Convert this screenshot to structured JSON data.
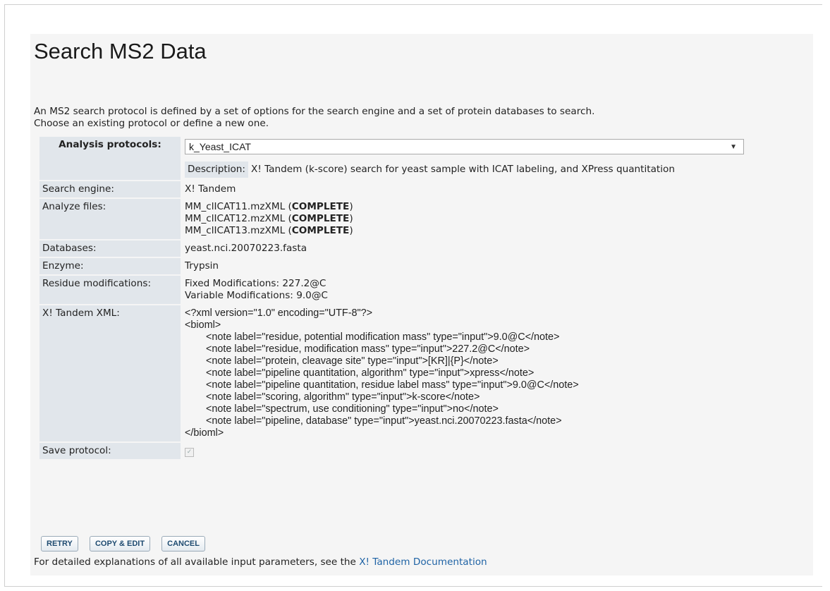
{
  "page": {
    "title": "Search MS2 Data",
    "intro_line1": "An MS2 search protocol is defined by a set of options for the search engine and a set of protein databases to search.",
    "intro_line2": "Choose an existing protocol or define a new one."
  },
  "form": {
    "protocol_label": "Analysis protocols:",
    "protocol_value": "k_Yeast_ICAT",
    "description_label": "Description:",
    "description_value": "X! Tandem (k-score) search for yeast sample with ICAT labeling, and XPress quantitation",
    "engine_label": "Search engine:",
    "engine_value": "X! Tandem",
    "files_label": "Analyze files:",
    "files": [
      {
        "name": "MM_clICAT11.mzXML",
        "status": "COMPLETE"
      },
      {
        "name": "MM_clICAT12.mzXML",
        "status": "COMPLETE"
      },
      {
        "name": "MM_clICAT13.mzXML",
        "status": "COMPLETE"
      }
    ],
    "databases_label": "Databases:",
    "databases_value": "yeast.nci.20070223.fasta",
    "enzyme_label": "Enzyme:",
    "enzyme_value": "Trypsin",
    "residue_label": "Residue modifications:",
    "residue_fixed": "Fixed Modifications: 227.2@C",
    "residue_variable": "Variable Modifications: 9.0@C",
    "xml_label": "X! Tandem XML:",
    "xml_lines": [
      "<?xml version=\"1.0\" encoding=\"UTF-8\"?>",
      "<bioml>",
      "<note label=\"residue, potential modification mass\" type=\"input\">9.0@C</note>",
      "<note label=\"residue, modification mass\" type=\"input\">227.2@C</note>",
      "<note label=\"protein, cleavage site\" type=\"input\">[KR]|{P}</note>",
      "<note label=\"pipeline quantitation, algorithm\" type=\"input\">xpress</note>",
      "<note label=\"pipeline quantitation, residue label mass\" type=\"input\">9.0@C</note>",
      "<note label=\"scoring, algorithm\" type=\"input\">k-score</note>",
      "<note label=\"spectrum, use conditioning\" type=\"input\">no</note>",
      "<note label=\"pipeline, database\" type=\"input\">yeast.nci.20070223.fasta</note>",
      "</bioml>"
    ],
    "save_label": "Save protocol:",
    "save_checked": true
  },
  "buttons": {
    "retry": "RETRY",
    "copy_edit": "COPY & EDIT",
    "cancel": "CANCEL"
  },
  "footer": {
    "text": "For detailed explanations of all available input parameters, see the ",
    "link": "X! Tandem Documentation"
  },
  "colors": {
    "label_bg": "#e1e6eb",
    "panel_bg": "#f5f5f5",
    "link": "#1f63a5"
  }
}
